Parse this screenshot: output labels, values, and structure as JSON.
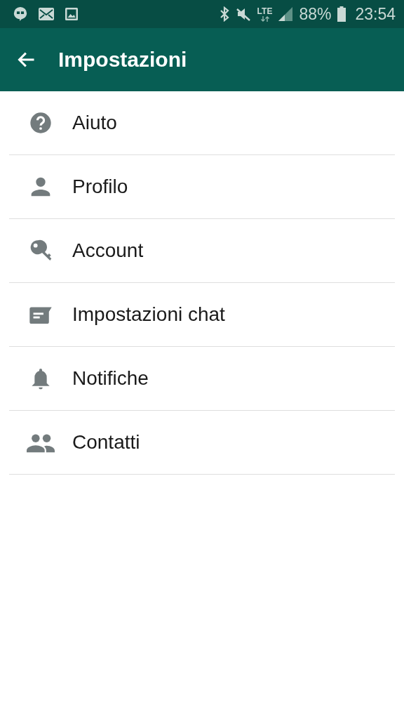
{
  "status_bar": {
    "network": "LTE",
    "battery": "88%",
    "time": "23:54"
  },
  "app_bar": {
    "title": "Impostazioni"
  },
  "items": [
    {
      "kind": "help",
      "label": "Aiuto"
    },
    {
      "kind": "profile",
      "label": "Profilo"
    },
    {
      "kind": "account",
      "label": "Account"
    },
    {
      "kind": "chat",
      "label": "Impostazioni chat"
    },
    {
      "kind": "notifications",
      "label": "Notifiche"
    },
    {
      "kind": "contacts",
      "label": "Contatti"
    }
  ]
}
